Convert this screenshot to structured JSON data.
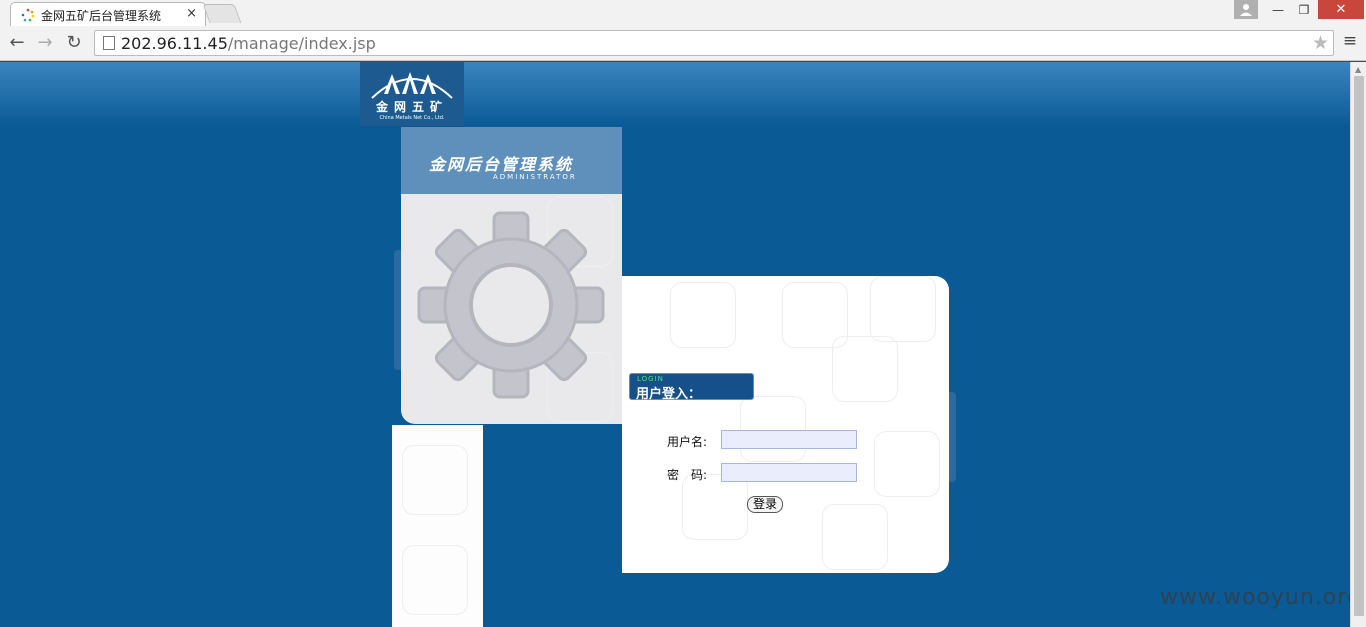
{
  "browser": {
    "tab_title": "金网五矿后台管理系统",
    "tab_close": "×",
    "url_host": "202.96.11.45",
    "url_path": "/manage/index.jsp",
    "window_controls": {
      "minimize": "—",
      "restore": "❐",
      "close": "✕"
    }
  },
  "logo": {
    "name": "金网五矿",
    "subtitle": "China Metals Net Co., Ltd."
  },
  "left_panel": {
    "title": "金网后台管理系统",
    "subtitle": "ADMINISTRATOR"
  },
  "login": {
    "badge_en": "LOGIN",
    "badge_cn": "用户登入：",
    "username_label": "用户名:",
    "username_value": "",
    "password_label": "密　码:",
    "password_value": "",
    "submit_label": "登录"
  },
  "watermark": "www.wooyun.org",
  "colors": {
    "page_bg": "#0a5a96",
    "header_blue": "#5f90bb",
    "input_bg": "#eaedfb",
    "close_red": "#c9463d",
    "login_badge": "#16508a"
  }
}
